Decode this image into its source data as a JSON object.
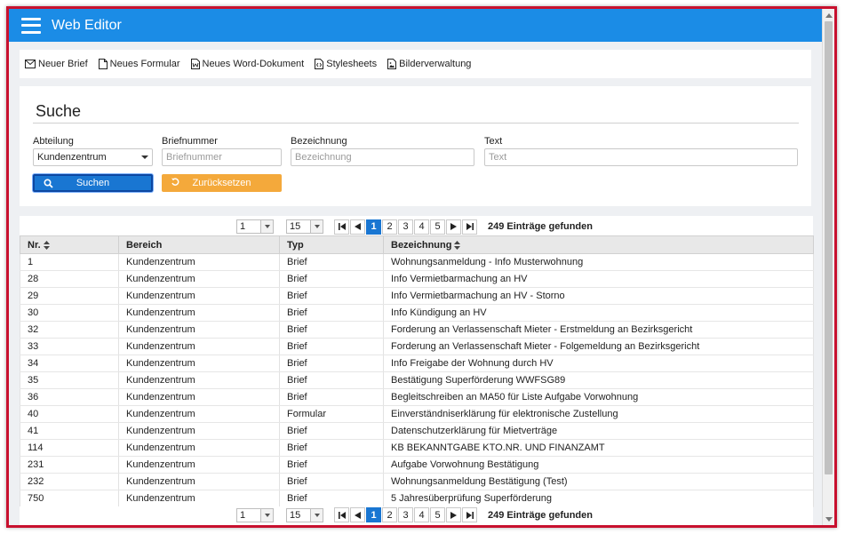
{
  "app": {
    "title": "Web Editor"
  },
  "toolbar": [
    {
      "label": "Neuer Brief",
      "icon": "envelope-icon"
    },
    {
      "label": "Neues Formular",
      "icon": "document-icon"
    },
    {
      "label": "Neues Word-Dokument",
      "icon": "word-document-icon"
    },
    {
      "label": "Stylesheets",
      "icon": "stylesheet-icon"
    },
    {
      "label": "Bilderverwaltung",
      "icon": "image-file-icon"
    }
  ],
  "search": {
    "title": "Suche",
    "abteilung": {
      "label": "Abteilung",
      "value": "Kundenzentrum"
    },
    "briefnummer": {
      "label": "Briefnummer",
      "placeholder": "Briefnummer"
    },
    "bezeichnung": {
      "label": "Bezeichnung",
      "placeholder": "Bezeichnung"
    },
    "text": {
      "label": "Text",
      "placeholder": "Text"
    },
    "search_button": "Suchen",
    "reset_button": "Zurücksetzen"
  },
  "pager": {
    "page_select": "1",
    "page_size": "15",
    "pages": [
      "1",
      "2",
      "3",
      "4",
      "5"
    ],
    "active_page": "1",
    "count_text": "249 Einträge gefunden"
  },
  "table": {
    "columns": [
      "Nr.",
      "Bereich",
      "Typ",
      "Bezeichnung"
    ],
    "rows": [
      [
        "1",
        "Kundenzentrum",
        "Brief",
        "Wohnungsanmeldung - Info Musterwohnung"
      ],
      [
        "28",
        "Kundenzentrum",
        "Brief",
        "Info Vermietbarmachung an HV"
      ],
      [
        "29",
        "Kundenzentrum",
        "Brief",
        "Info Vermietbarmachung an HV - Storno"
      ],
      [
        "30",
        "Kundenzentrum",
        "Brief",
        "Info Kündigung an HV"
      ],
      [
        "32",
        "Kundenzentrum",
        "Brief",
        "Forderung an Verlassenschaft Mieter - Erstmeldung an Bezirksgericht"
      ],
      [
        "33",
        "Kundenzentrum",
        "Brief",
        "Forderung an Verlassenschaft Mieter - Folgemeldung an Bezirksgericht"
      ],
      [
        "34",
        "Kundenzentrum",
        "Brief",
        "Info Freigabe der Wohnung durch HV"
      ],
      [
        "35",
        "Kundenzentrum",
        "Brief",
        "Bestätigung Superförderung WWFSG89"
      ],
      [
        "36",
        "Kundenzentrum",
        "Brief",
        "Begleitschreiben an MA50 für Liste Aufgabe Vorwohnung"
      ],
      [
        "40",
        "Kundenzentrum",
        "Formular",
        "Einverständniserklärung für elektronische Zustellung"
      ],
      [
        "41",
        "Kundenzentrum",
        "Brief",
        "Datenschutzerklärung für Mietverträge"
      ],
      [
        "114",
        "Kundenzentrum",
        "Brief",
        "KB BEKANNTGABE KTO.NR. UND FINANZAMT"
      ],
      [
        "231",
        "Kundenzentrum",
        "Brief",
        "Aufgabe Vorwohnung Bestätigung"
      ],
      [
        "232",
        "Kundenzentrum",
        "Brief",
        "Wohnungsanmeldung Bestätigung (Test)"
      ],
      [
        "750",
        "Kundenzentrum",
        "Brief",
        "5 Jahresüberprüfung Superförderung"
      ]
    ]
  },
  "colors": {
    "header": "#1b8ce6",
    "primary": "#1976d2",
    "warning": "#f4a93b",
    "frame": "#c8102e"
  }
}
